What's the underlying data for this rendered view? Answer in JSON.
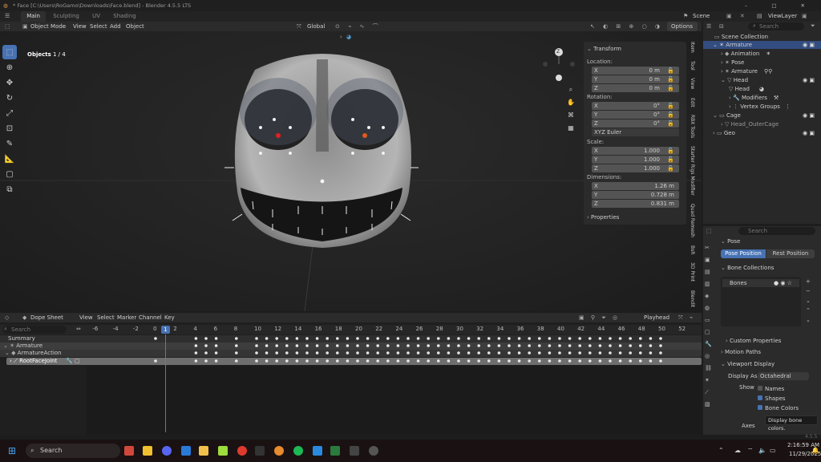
{
  "window": {
    "title": "* Face [C:\\Users\\RoGamo\\Downloads\\Face.blend] - Blender 4.5.5 LTS",
    "buttons": "– □ ✕"
  },
  "menu": {
    "workspaces": [
      "Main",
      "Sculpting",
      "UV",
      "Shading"
    ],
    "scene_label": "Scene",
    "viewlayer_label": "ViewLayer"
  },
  "viewport_header": {
    "mode": "Object Mode",
    "menus": [
      "View",
      "Select",
      "Add",
      "Object"
    ],
    "orientation": "Global",
    "options": "Options"
  },
  "viewport": {
    "objects_label": "Objects",
    "objects_count": "1 / 4",
    "gizmo_axis": "Z"
  },
  "n_panel": {
    "transform": "Transform",
    "location_label": "Location:",
    "location": [
      {
        "axis": "X",
        "value": "0 m"
      },
      {
        "axis": "Y",
        "value": "0 m"
      },
      {
        "axis": "Z",
        "value": "0 m"
      }
    ],
    "rotation_label": "Rotation:",
    "rotation": [
      {
        "axis": "X",
        "value": "0°"
      },
      {
        "axis": "Y",
        "value": "0°"
      },
      {
        "axis": "Z",
        "value": "0°"
      }
    ],
    "rotation_mode": "XYZ Euler",
    "scale_label": "Scale:",
    "scale": [
      {
        "axis": "X",
        "value": "1.000"
      },
      {
        "axis": "Y",
        "value": "1.000"
      },
      {
        "axis": "Z",
        "value": "1.000"
      }
    ],
    "dimensions_label": "Dimensions:",
    "dimensions": [
      {
        "axis": "X",
        "value": "1.26 m"
      },
      {
        "axis": "Y",
        "value": "0.728 m"
      },
      {
        "axis": "Z",
        "value": "0.831 m"
      }
    ],
    "properties": "Properties"
  },
  "side_tabs": [
    "Item",
    "Tool",
    "View",
    "Edit",
    "RBX Tools",
    "Starter Rigs Modifier",
    "Quad Remesh",
    "BsR",
    "3D Print",
    "Blendit"
  ],
  "outliner": {
    "search_placeholder": "Search",
    "items": [
      {
        "label": "Scene Collection",
        "indent": 0
      },
      {
        "label": "Armature",
        "indent": 1
      },
      {
        "label": "Animation",
        "indent": 2
      },
      {
        "label": "Pose",
        "indent": 2
      },
      {
        "label": "Armature",
        "indent": 2
      },
      {
        "label": "Head",
        "indent": 2
      },
      {
        "label": "Head",
        "indent": 3
      },
      {
        "label": "Modifiers",
        "indent": 3
      },
      {
        "label": "Vertex Groups",
        "indent": 3
      },
      {
        "label": "Cage",
        "indent": 1
      },
      {
        "label": "Head_OuterCage",
        "indent": 2
      },
      {
        "label": "Geo",
        "indent": 1
      }
    ]
  },
  "properties_panel": {
    "search_placeholder": "Search",
    "pose": "Pose",
    "pose_position": "Pose Position",
    "rest_position": "Rest Position",
    "bone_collections": "Bone Collections",
    "bones": "Bones",
    "custom_properties": "Custom Properties",
    "motion_paths": "Motion Paths",
    "viewport_display": "Viewport Display",
    "display_as_label": "Display As",
    "display_as_value": "Octahedral",
    "show_label": "Show",
    "names": "Names",
    "shapes": "Shapes",
    "bone_colors": "Bone Colors",
    "axes": "Axes",
    "tooltip": "Display bone colors."
  },
  "dope_sheet": {
    "editor": "Dope Sheet",
    "menus": [
      "View",
      "Select",
      "Marker",
      "Channel",
      "Key"
    ],
    "playhead": "Playhead",
    "search_placeholder": "Search",
    "channels": [
      "Summary",
      "Armature",
      "ArmatureAction",
      "RootFaceJoint"
    ],
    "frame_ticks": [
      "-6",
      "-4",
      "-2",
      "0",
      "1",
      "2",
      "4",
      "6",
      "8",
      "10",
      "12",
      "14",
      "16",
      "18",
      "20",
      "22",
      "24",
      "26",
      "28",
      "30",
      "32",
      "34",
      "36",
      "38",
      "40",
      "42",
      "44",
      "46",
      "48",
      "50",
      "52"
    ],
    "current_frame": "1"
  },
  "status": {
    "version": "4.5.5"
  },
  "taskbar": {
    "search_placeholder": "Search",
    "time": "2:16:59 AM",
    "date": "11/29/2025"
  },
  "colors": {
    "accent": "#4772b3",
    "bg": "#1d1d1d",
    "panel": "#2b2b2b"
  }
}
